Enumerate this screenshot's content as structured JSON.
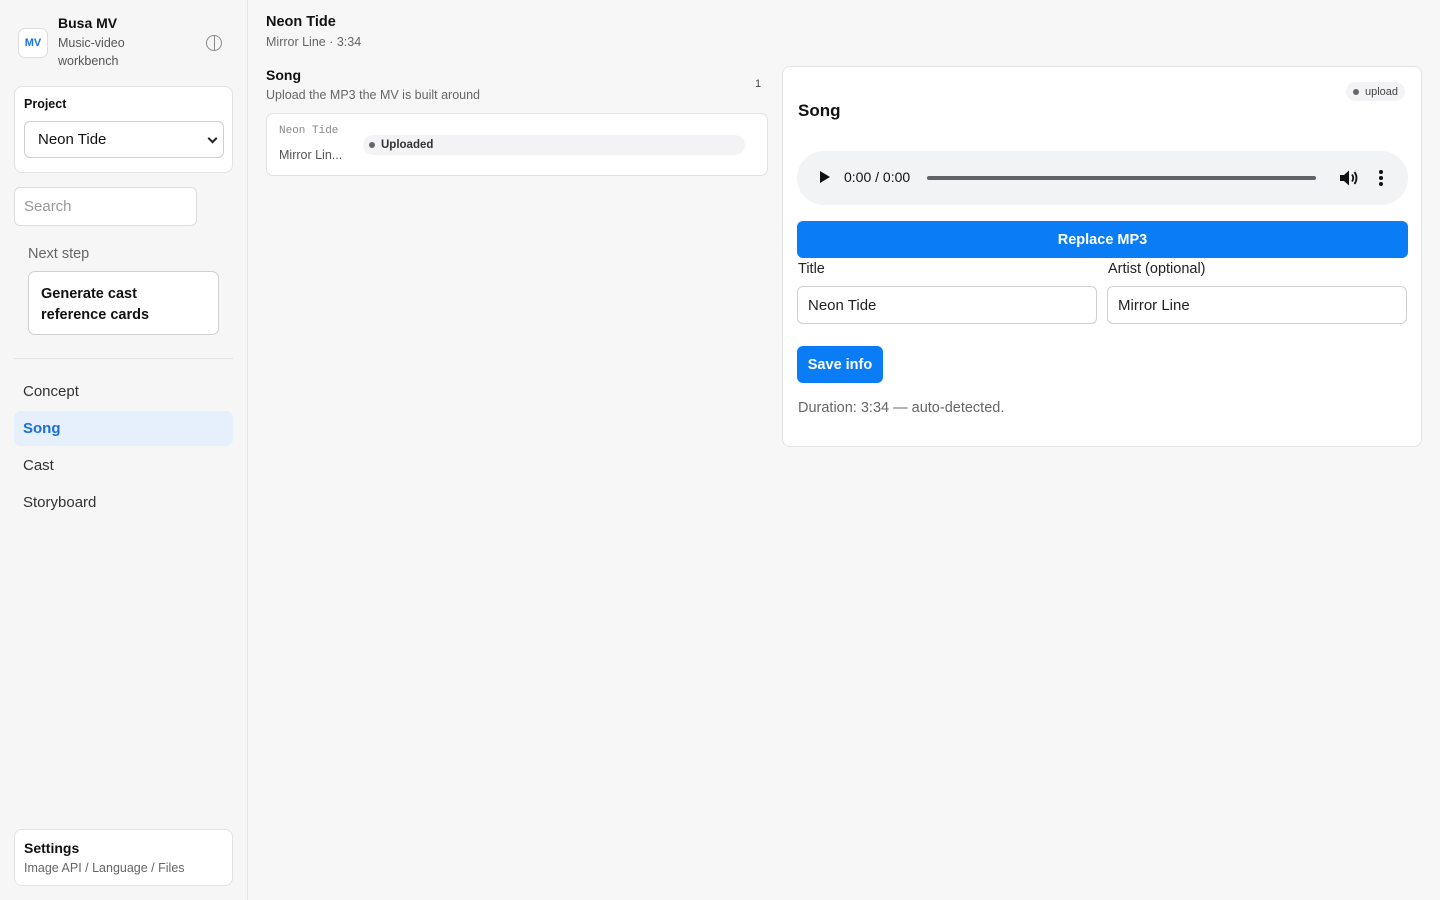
{
  "brand": {
    "logo": "MV",
    "name": "Busa MV",
    "subtitle": "Music-video workbench",
    "theme_icon": "half-circle-icon"
  },
  "project": {
    "label": "Project",
    "selected": "Neon Tide"
  },
  "search": {
    "placeholder": "Search"
  },
  "next_step": {
    "label": "Next step",
    "action": "Generate cast reference cards"
  },
  "nav": {
    "items": [
      {
        "label": "Concept",
        "active": false
      },
      {
        "label": "Song",
        "active": true
      },
      {
        "label": "Cast",
        "active": false
      },
      {
        "label": "Storyboard",
        "active": false
      }
    ]
  },
  "settings": {
    "title": "Settings",
    "subtitle": "Image API / Language / Files"
  },
  "header": {
    "title": "Neon Tide",
    "subtitle": "Mirror Line · 3:34"
  },
  "section": {
    "title": "Song",
    "subtitle": "Upload the MP3 the MV is built around",
    "count": "1"
  },
  "song_card": {
    "title": "Neon Tide",
    "artist": "Mirror Lin...",
    "status": "Uploaded"
  },
  "detail": {
    "title": "Song",
    "badge": "upload",
    "player": {
      "time": "0:00 / 0:00"
    },
    "replace_label": "Replace MP3",
    "title_label": "Title",
    "title_value": "Neon Tide",
    "artist_label": "Artist (optional)",
    "artist_value": "Mirror Line",
    "save_label": "Save info",
    "duration_text": "Duration: 3:34 — auto-detected."
  },
  "colors": {
    "accent": "#0a7cf5",
    "active_nav_bg": "#e6f0fd",
    "active_nav_text": "#1a6fd6"
  }
}
